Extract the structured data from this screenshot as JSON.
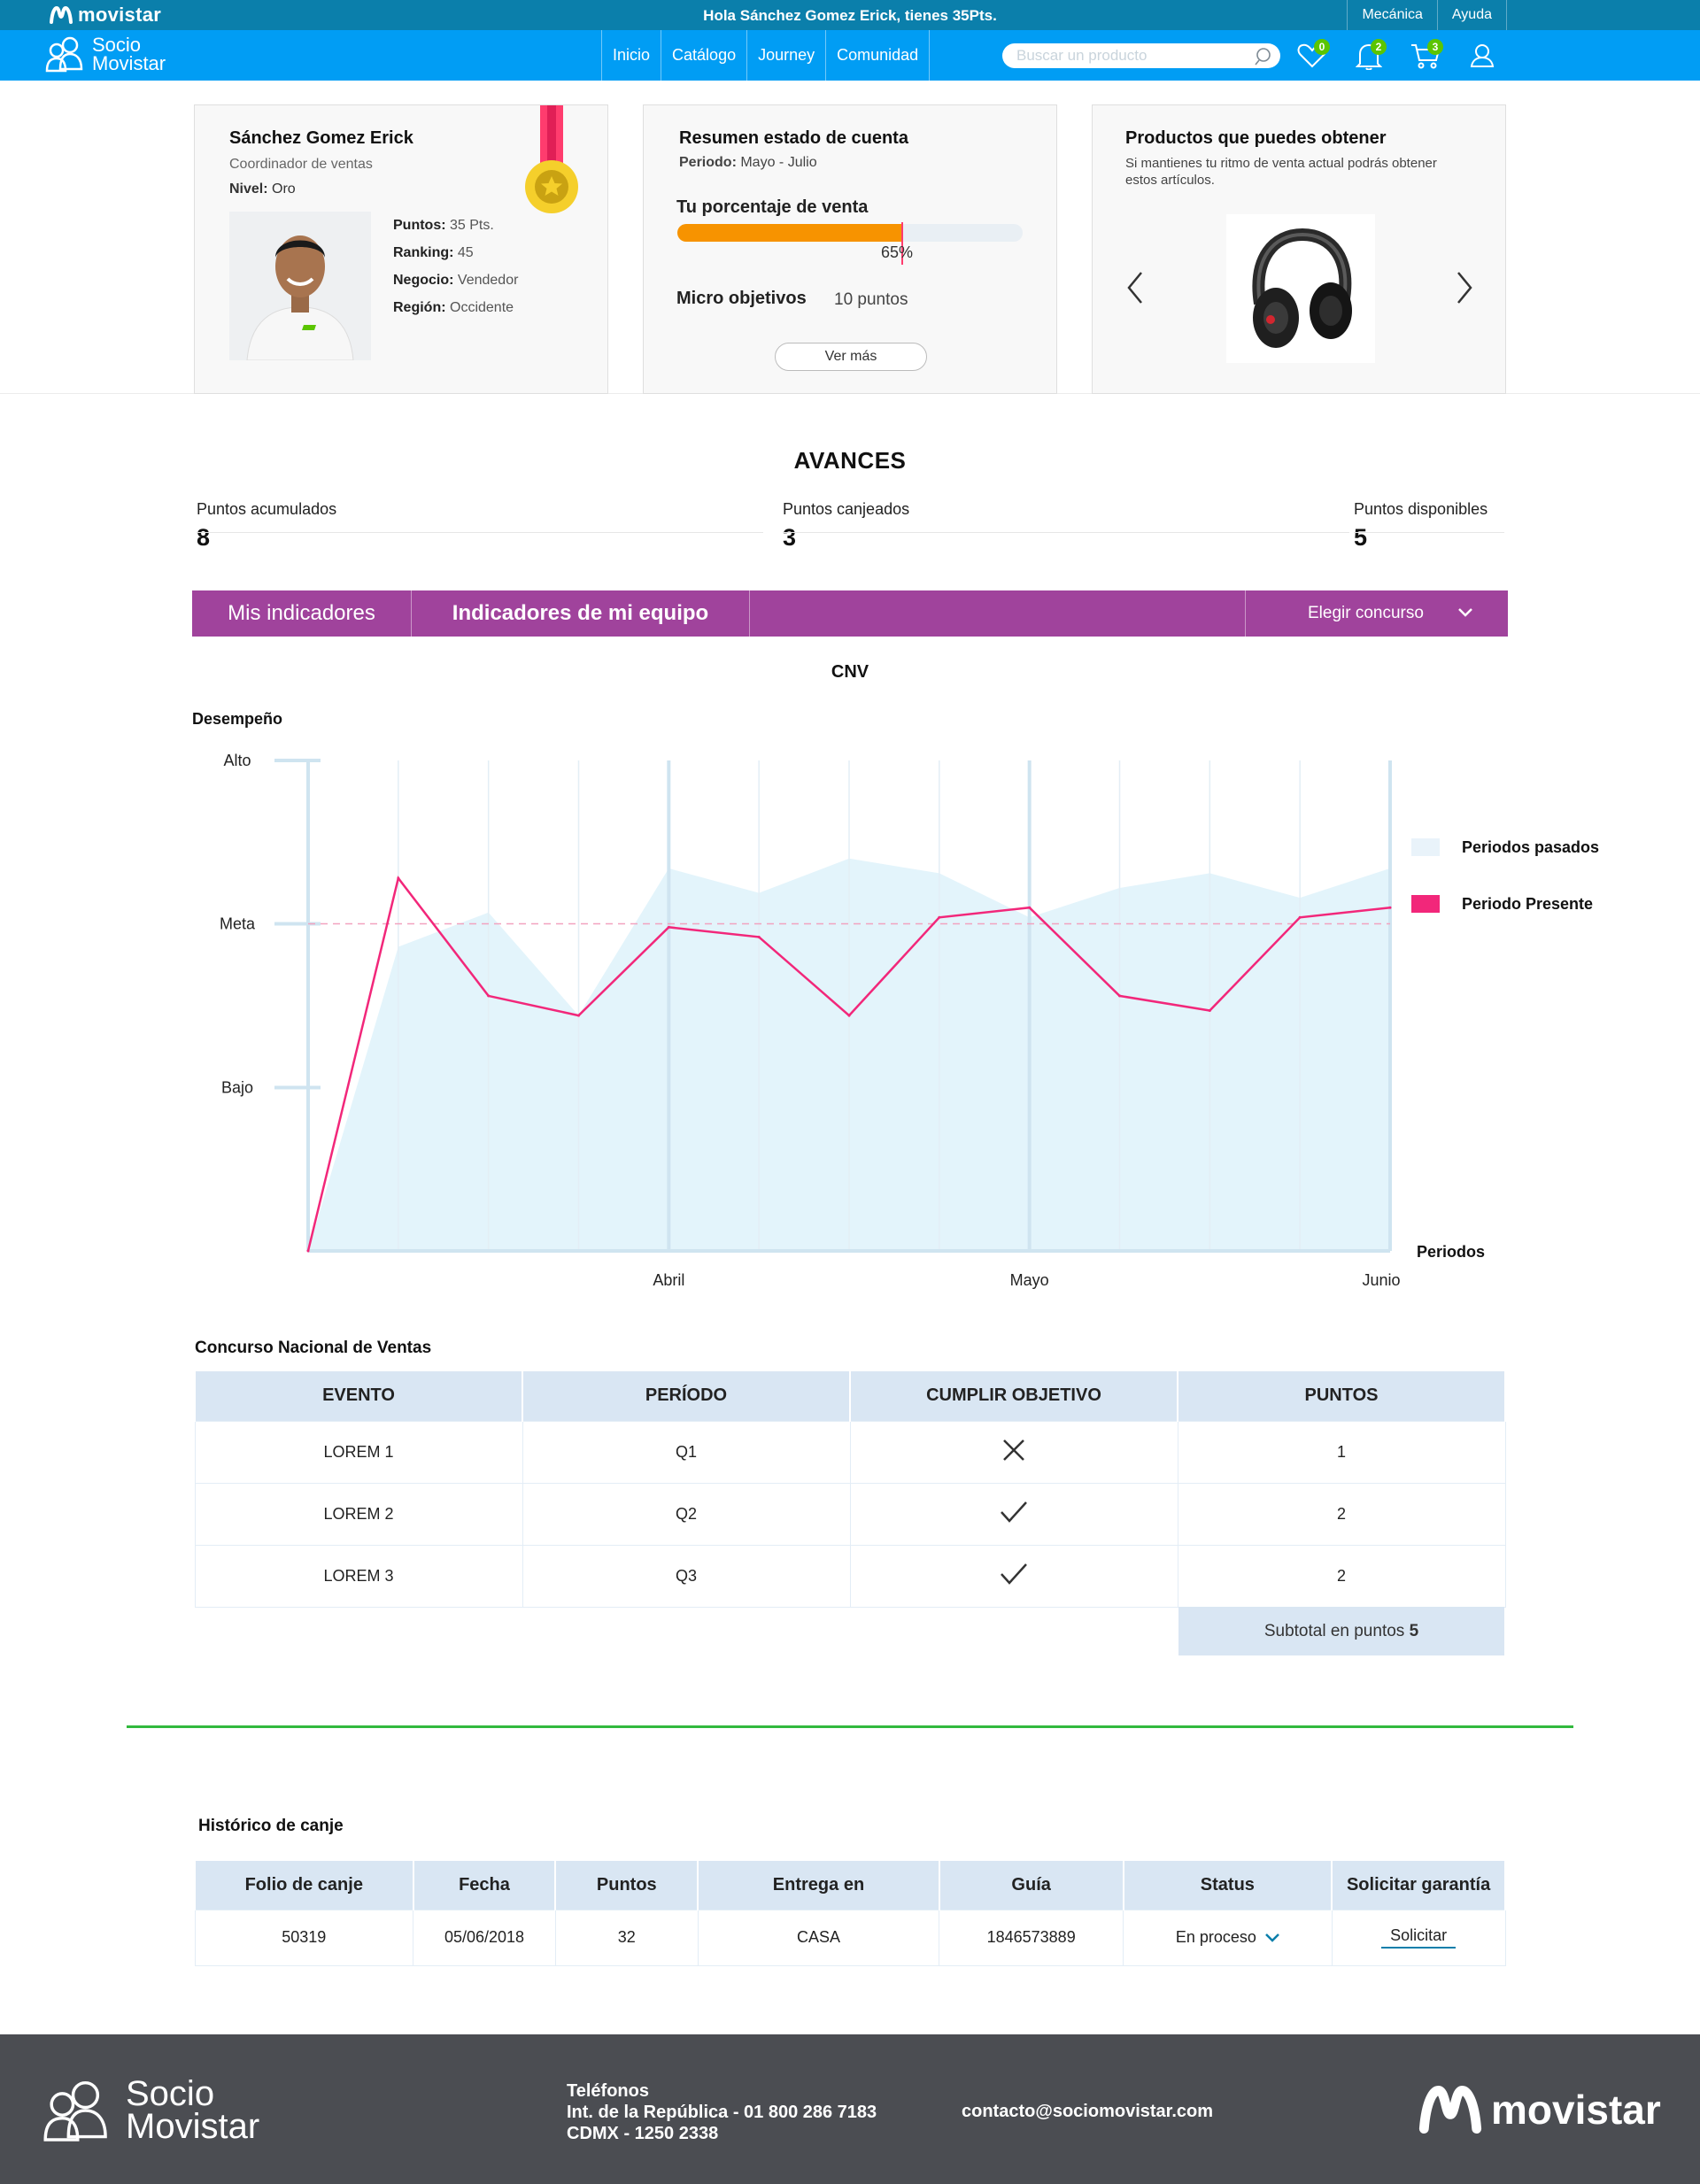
{
  "topbar": {
    "brand": "movistar",
    "greeting": "Hola Sánchez Gomez Erick, tienes 35Pts.",
    "links": [
      "Mecánica",
      "Ayuda"
    ]
  },
  "nav": {
    "logo_line1": "Socio",
    "logo_line2": "Movistar",
    "menu": [
      "Inicio",
      "Catálogo",
      "Journey",
      "Comunidad"
    ],
    "search_placeholder": "Buscar un producto",
    "badges": {
      "favorites": "0",
      "notifications": "2",
      "cart": "3"
    },
    "icons": [
      "heart-icon",
      "bell-icon",
      "cart-icon",
      "user-icon"
    ]
  },
  "profile": {
    "name": "Sánchez Gomez Erick",
    "role": "Coordinador de ventas",
    "level_label": "Nivel:",
    "level": "Oro",
    "points_label": "Puntos:",
    "points": "35 Pts.",
    "ranking_label": "Ranking:",
    "ranking": "45",
    "business_label": "Negocio:",
    "business": "Vendedor",
    "region_label": "Región:",
    "region": "Occidente"
  },
  "account": {
    "title": "Resumen estado de cuenta",
    "period_label": "Periodo:",
    "period": "Mayo - Julio",
    "sales_label": "Tu porcentaje de venta",
    "sales_percent": 65,
    "sales_percent_text": "65%",
    "micro_label": "Micro objetivos",
    "micro_value": "10 puntos",
    "more_button": "Ver más"
  },
  "products": {
    "title": "Productos que puedes obtener",
    "description": "Si mantienes tu ritmo de venta actual podrás obtener estos artículos."
  },
  "avances": {
    "title": "AVANCES",
    "stats": [
      {
        "label": "Puntos acumulados",
        "value": "8"
      },
      {
        "label": "Puntos canjeados",
        "value": "3"
      },
      {
        "label": "Puntos disponibles",
        "value": "5"
      }
    ]
  },
  "tabs": {
    "mine": "Mis indicadores",
    "team": "Indicadores de mi equipo",
    "contest_select": "Elegir concurso"
  },
  "chart_data": {
    "type": "line",
    "title": "CNV",
    "ylabel": "Desempeño",
    "xlabel": "Periodos",
    "y_ticks": [
      "Bajo",
      "Meta",
      "Alto"
    ],
    "x_ticks": [
      "Abril",
      "Mayo",
      "Junio"
    ],
    "ylim": [
      0,
      100
    ],
    "meta_level": 66.7,
    "legend_position": "right",
    "colors": {
      "past": "#e3f4fb",
      "present": "#f2277a",
      "meta": "#f2a2bf"
    },
    "series": [
      {
        "name": "Periodos pasados",
        "type": "area",
        "values": [
          0,
          62,
          69,
          48,
          78,
          73,
          80,
          77,
          68,
          74,
          77,
          72,
          78
        ]
      },
      {
        "name": "Periodo Presente",
        "type": "line",
        "values": [
          0,
          76,
          52,
          48,
          66,
          64,
          48,
          68,
          70,
          52,
          49,
          68,
          70
        ]
      }
    ]
  },
  "contest": {
    "title": "Concurso Nacional de Ventas",
    "headers": [
      "EVENTO",
      "PERÍODO",
      "CUMPLIR OBJETIVO",
      "PUNTOS"
    ],
    "rows": [
      {
        "event": "LOREM 1",
        "period": "Q1",
        "met": false,
        "points": "1"
      },
      {
        "event": "LOREM 2",
        "period": "Q2",
        "met": true,
        "points": "2"
      },
      {
        "event": "LOREM 3",
        "period": "Q3",
        "met": true,
        "points": "2"
      }
    ],
    "subtotal_label": "Subtotal en puntos",
    "subtotal_value": "5"
  },
  "history": {
    "title": "Histórico de canje",
    "headers": [
      "Folio de canje",
      "Fecha",
      "Puntos",
      "Entrega en",
      "Guía",
      "Status",
      "Solicitar garantía"
    ],
    "rows": [
      {
        "folio": "50319",
        "date": "05/06/2018",
        "points": "32",
        "delivery": "CASA",
        "guide": "1846573889",
        "status": "En proceso",
        "action": "Solicitar"
      }
    ]
  },
  "footer": {
    "logo_line1": "Socio",
    "logo_line2": "Movistar",
    "phones_title": "Teléfonos",
    "phone1": "Int. de la República - 01 800 286 7183",
    "phone2": "CDMX - 1250 2338",
    "email": "contacto@sociomovistar.com",
    "brand": "movistar"
  },
  "colors": {
    "topbar": "#0b7fab",
    "nav": "#019df4",
    "purple": "#a0439c",
    "orange": "#f79300",
    "pink": "#f2277a",
    "green": "#32b93d",
    "table_header": "#d9e6f3",
    "footer": "#4b4d52"
  }
}
